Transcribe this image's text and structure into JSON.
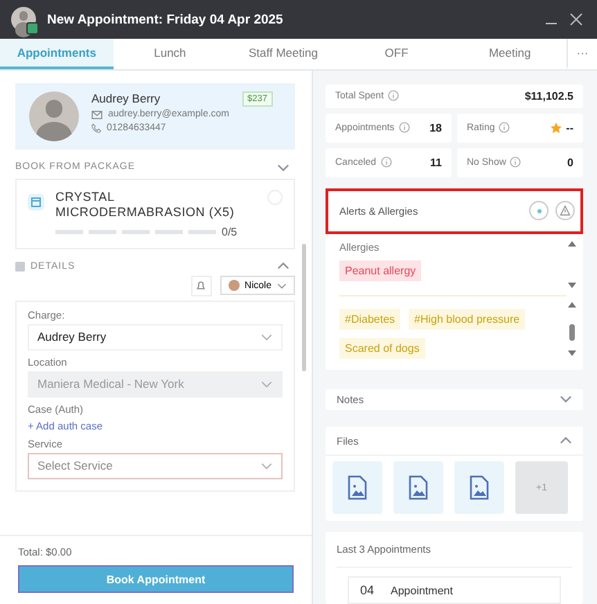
{
  "window": {
    "title": "New Appointment: Friday 04 Apr 2025"
  },
  "tabs": [
    {
      "label": "Appointments",
      "selected": true
    },
    {
      "label": "Lunch",
      "selected": false
    },
    {
      "label": "Staff Meeting",
      "selected": false
    },
    {
      "label": "OFF",
      "selected": false
    },
    {
      "label": "Meeting",
      "selected": false
    },
    {
      "label": "···",
      "selected": false
    }
  ],
  "client": {
    "name": "Audrey Berry",
    "email": "audrey.berry@example.com",
    "phone": "01284633447",
    "balance": "$237"
  },
  "package": {
    "heading": "BOOK FROM PACKAGE",
    "expanded": false,
    "title": "CRYSTAL MICRODERMABRASION (X5)",
    "level": 0,
    "progress": "0/5",
    "selected": false
  },
  "details": {
    "heading": "DETAILS",
    "expanded": true,
    "staff": "Nicole",
    "fields": [
      {
        "label": "Charge:",
        "value": "Audrey Berry",
        "kind": "select",
        "disabled": false
      },
      {
        "label": "Location",
        "value": "Maniera Medical - New York",
        "kind": "select",
        "disabled": true
      },
      {
        "label": "Case (Auth)",
        "value": "+ Add auth case",
        "kind": "link"
      },
      {
        "label": "Service",
        "placeholder": "Select Service",
        "kind": "select",
        "disabled": false
      }
    ]
  },
  "footer": {
    "total": "Total: $0.00",
    "button": "Book Appointment"
  },
  "stats": [
    {
      "label": "Total Spent",
      "value": "$11,102.5",
      "kind": "number"
    },
    {
      "label": "Appointments",
      "value": "18",
      "kind": "number"
    },
    {
      "label": "Rating",
      "value": "--",
      "kind": "rating"
    },
    {
      "label": "Canceled",
      "value": "11",
      "kind": "number"
    },
    {
      "label": "No Show",
      "value": "0",
      "kind": "number"
    }
  ],
  "alerts": {
    "title": "Alerts & Allergies",
    "highlighted": true,
    "subtitle": "Allergies",
    "allergy_tags": [
      {
        "label": "Peanut allergy",
        "color": "#e8475a"
      }
    ],
    "alert_tags": [
      {
        "label": "#Diabetes",
        "color": "#c9a30a"
      },
      {
        "label": "#High blood pressure",
        "color": "#c9a30a"
      },
      {
        "label": "Scared of dogs",
        "color": "#c9a30a"
      }
    ]
  },
  "notes": {
    "title": "Notes",
    "expanded": false
  },
  "files": {
    "title": "Files",
    "expanded": true,
    "items": [
      {
        "kind": "image"
      },
      {
        "kind": "image"
      },
      {
        "kind": "image"
      }
    ],
    "more": "+1"
  },
  "last_appointments": {
    "title": "Last 3 Appointments",
    "items": [
      {
        "day": "04",
        "label": "Appointment"
      }
    ]
  }
}
